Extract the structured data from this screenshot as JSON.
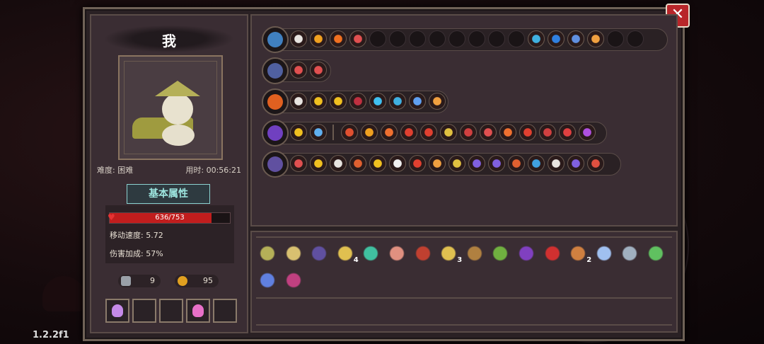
{
  "character": {
    "name": "我",
    "difficulty_label": "难度: 困难",
    "time_label": "用时: 00:56:21",
    "section_button": "基本属性"
  },
  "stats": {
    "hp_text": "636/753",
    "hp_fraction": 0.845,
    "move_speed": "移动速度: 5.72",
    "damage_bonus": "伤害加成: 57%"
  },
  "resources": {
    "keys": "9",
    "coins": "95"
  },
  "version": "1.2.2f1",
  "close_label": "✕",
  "colors": {
    "hp": "#c11d1d",
    "accent_teal": "#8bd2d0",
    "close": "#b8262a"
  },
  "rows": [
    {
      "weapon": "chest",
      "chips": [
        "skull",
        "chevron",
        "fire",
        "scroll",
        "empty",
        "empty",
        "empty",
        "empty",
        "empty",
        "empty",
        "empty",
        "empty",
        "swirl",
        "spiral",
        "wing",
        "arrow",
        "empty",
        "empty"
      ]
    },
    {
      "weapon": "orb",
      "chips": [
        "scroll",
        "scroll"
      ]
    },
    {
      "weapon": "axe",
      "chips": [
        "skull",
        "spin",
        "spin",
        "orb",
        "ice",
        "swirl",
        "dash",
        "arrow"
      ]
    },
    {
      "weapon": "staff",
      "chips": [
        "spin",
        "bottle",
        "|",
        "wings",
        "chevron",
        "sun",
        "claw",
        "claw",
        "burst",
        "hourglass",
        "scroll",
        "sun",
        "claw",
        "hourglass",
        "diamond",
        "potion"
      ]
    },
    {
      "weapon": "staff2",
      "chips": [
        "target",
        "spin",
        "skull",
        "blade",
        "spin",
        "mouse",
        "claw",
        "arrow",
        "burst",
        "slash",
        "slash",
        "blade",
        "rainbow",
        "skull",
        "slash",
        "heart"
      ]
    }
  ],
  "items": [
    {
      "name": "hat-icon",
      "count": ""
    },
    {
      "name": "glove-icon",
      "count": ""
    },
    {
      "name": "boots-icon",
      "count": ""
    },
    {
      "name": "gem-icon",
      "count": "4"
    },
    {
      "name": "shell-icon",
      "count": ""
    },
    {
      "name": "stone-icon",
      "count": ""
    },
    {
      "name": "mat-icon",
      "count": ""
    },
    {
      "name": "antler-icon",
      "count": "3"
    },
    {
      "name": "crate-icon",
      "count": ""
    },
    {
      "name": "bug-icon",
      "count": ""
    },
    {
      "name": "wizard-hat-icon",
      "count": ""
    },
    {
      "name": "demon-icon",
      "count": ""
    },
    {
      "name": "pickaxe-icon",
      "count": "2"
    },
    {
      "name": "crystal-icon",
      "count": ""
    },
    {
      "name": "sword-icon",
      "count": ""
    },
    {
      "name": "leaf-icon",
      "count": ""
    },
    {
      "name": "drop-icon",
      "count": ""
    },
    {
      "name": "cape-icon",
      "count": ""
    }
  ]
}
